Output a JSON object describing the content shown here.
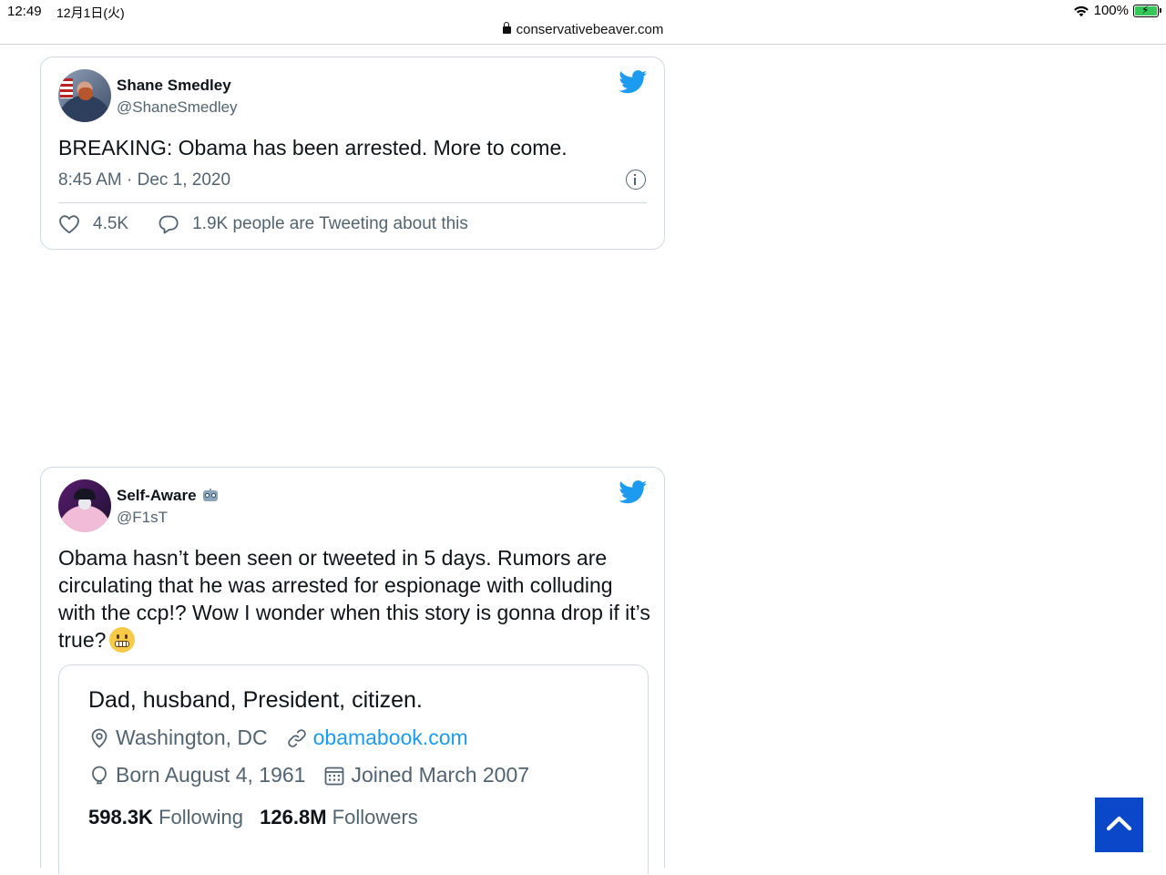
{
  "statusbar": {
    "time": "12:49",
    "date": "12月1日(火)",
    "battery": "100%",
    "wifi_icon": "wifi-icon",
    "battery_icon": "battery-charging-icon"
  },
  "addressbar": {
    "url": "conservativebeaver.com",
    "lock_icon": "lock-icon"
  },
  "tweets": [
    {
      "name": "Shane Smedley",
      "handle": "@ShaneSmedley",
      "text": "BREAKING: Obama has been arrested. More to come.",
      "timestamp": "8:45 AM · Dec 1, 2020",
      "likes": "4.5K",
      "replies_text": "1.9K people are Tweeting about this"
    },
    {
      "name": "Self-Aware",
      "name_emoji": "robot-emoji",
      "handle": "@F1sT",
      "text": "Obama hasn’t been seen or tweeted in 5 days. Rumors are circulating that he was arrested for espionage with colluding with the ccp!? Wow I wonder when this story is gonna drop if it’s true?",
      "text_emoji": "grimacing-face-emoji",
      "embedded_profile": {
        "bio": "Dad, husband, President, citizen.",
        "location": "Washington, DC",
        "website": "obamabook.com",
        "born": "Born August 4, 1961",
        "joined": "Joined March 2007",
        "following_count": "598.3K",
        "following_label": "Following",
        "followers_count": "126.8M",
        "followers_label": "Followers"
      }
    }
  ],
  "colors": {
    "twitter_blue": "#1d9bf0",
    "muted_text": "#536471",
    "border": "#cfd9de",
    "scroll_button": "#0a48c9"
  },
  "scroll_top_icon": "chevron-up-icon"
}
